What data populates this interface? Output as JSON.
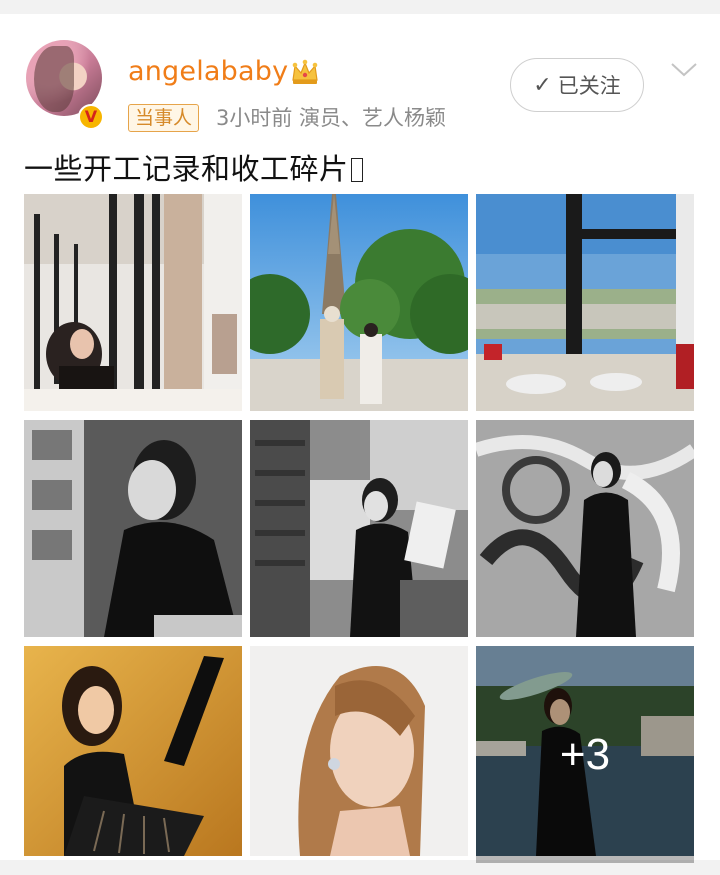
{
  "post": {
    "username": "angelababy",
    "tag": "当事人",
    "meta": "3小时前   演员、艺人杨颖",
    "follow_label": "已关注",
    "text": "一些开工记录和收工碎片",
    "text_suffix": "\u0000",
    "more_count_label": "+3"
  },
  "photos": [
    {
      "desc": "restaurant-window-selfie"
    },
    {
      "desc": "eiffel-tower-walk"
    },
    {
      "desc": "window-view-table"
    },
    {
      "desc": "bw-portrait-shelves"
    },
    {
      "desc": "bw-reading-newspaper"
    },
    {
      "desc": "bw-graffiti-wall"
    },
    {
      "desc": "gold-room-black-gown"
    },
    {
      "desc": "profile-portrait"
    },
    {
      "desc": "riverside-black-dress"
    }
  ],
  "colors": {
    "username": "#f07d18",
    "tag_border": "#e6a44a",
    "meta": "#8a8a8a"
  }
}
